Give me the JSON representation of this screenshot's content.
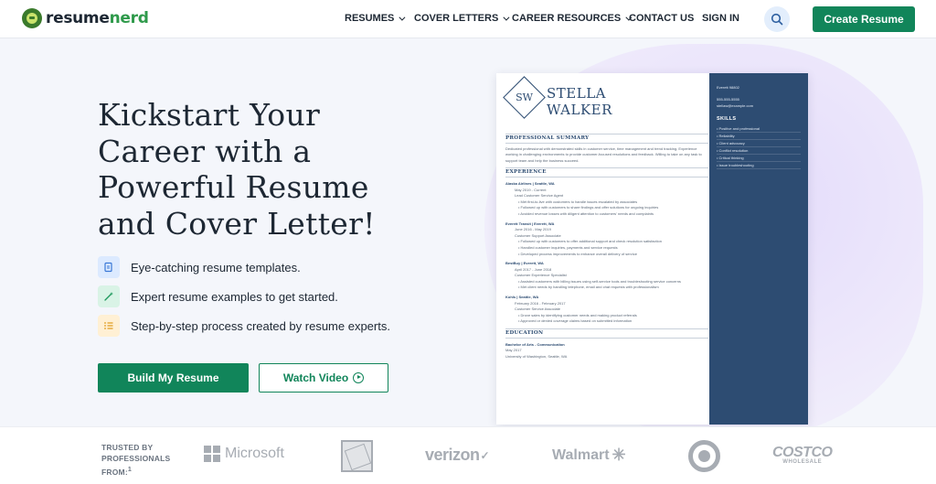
{
  "header": {
    "logo": {
      "part1": "resume",
      "part2": "nerd"
    },
    "nav": [
      {
        "label": "RESUMES",
        "has_dropdown": true
      },
      {
        "label": "COVER LETTERS",
        "has_dropdown": true
      },
      {
        "label": "CAREER RESOURCES",
        "has_dropdown": true
      },
      {
        "label": "CONTACT US",
        "has_dropdown": false
      },
      {
        "label": "SIGN IN",
        "has_dropdown": false
      }
    ],
    "search_icon": "search-icon",
    "cta_label": "Create Resume"
  },
  "hero": {
    "title_lines": [
      "Kickstart Your",
      "Career with a",
      "Powerful Resume",
      "and Cover Letter!"
    ],
    "features": [
      {
        "icon": "document-icon",
        "text": "Eye-catching resume templates."
      },
      {
        "icon": "magic-wand-icon",
        "text": "Expert resume examples to get started."
      },
      {
        "icon": "checklist-icon",
        "text": "Step-by-step process created by resume experts."
      }
    ],
    "primary_button": "Build My Resume",
    "secondary_button": "Watch Video"
  },
  "resume_preview": {
    "monogram": "SW",
    "first_name": "STELLA",
    "last_name": "WALKER",
    "contact": [
      "Everett 98802",
      "555-555-5555",
      "stellaw@example.com"
    ],
    "skills_title": "SKILLS",
    "skills": [
      "Positive and professional",
      "Reliability",
      "Client advocacy",
      "Conflict resolution",
      "Critical thinking",
      "Issue troubleshooting"
    ],
    "summary_title": "PROFESSIONAL SUMMARY",
    "summary": "Dedicated professional with demonstrated skills in customer service, time management and trend tracking. Experience working in challenging environments to provide customer-focused resolutions and feedback. Willing to take on any task to support team and help the business succeed.",
    "experience_title": "EXPERIENCE",
    "jobs": [
      {
        "employer": "Alaska Airlines | Seattle, WA",
        "dates": "May 2019 - Current",
        "role": "Lead Customer Service Agent",
        "bullets": [
          "Met first-to-live with customers to handle issues escalated by associates",
          "Followed up with customers to share findings and offer solutions for ongoing inquiries",
          "Avoided revenue losses with diligent attention to customers' needs and complaints"
        ]
      },
      {
        "employer": "Everett Transit | Everett, WA",
        "dates": "June 2016 - May 2019",
        "role": "Customer Support Associate",
        "bullets": [
          "Followed up with customers to offer additional support and check resolution satisfaction",
          "Handled customer inquiries, payments and service requests",
          "Developed process improvements to enhance overall delivery of service"
        ]
      },
      {
        "employer": "BestBuy | Everett, WA",
        "dates": "April 2017 - June 2018",
        "role": "Customer Experience Specialist",
        "bullets": [
          "Assisted customers with billing issues using self-service tools and troubleshooting service concerns",
          "Met client needs by handling telephone, email and chat requests with professionalism"
        ]
      },
      {
        "employer": "Kohls | Seattle, WA",
        "dates": "February 2016 - February 2017",
        "role": "Customer Service Associate",
        "bullets": [
          "Drove sales by identifying customer needs and making product referrals",
          "Approved or denied coverage claims based on submitted information"
        ]
      }
    ],
    "education_title": "EDUCATION",
    "education": [
      "Bachelor of Arts - Communication",
      "May 2017",
      "University of Washington, Seattle, WA"
    ]
  },
  "trusted": {
    "label": "TRUSTED BY PROFESSIONALS FROM:",
    "footnote": "1",
    "brands": [
      "Microsoft",
      "The Home Depot",
      "verizon",
      "Walmart",
      "Target",
      "COSTCO",
      "WHOLESALE"
    ]
  }
}
